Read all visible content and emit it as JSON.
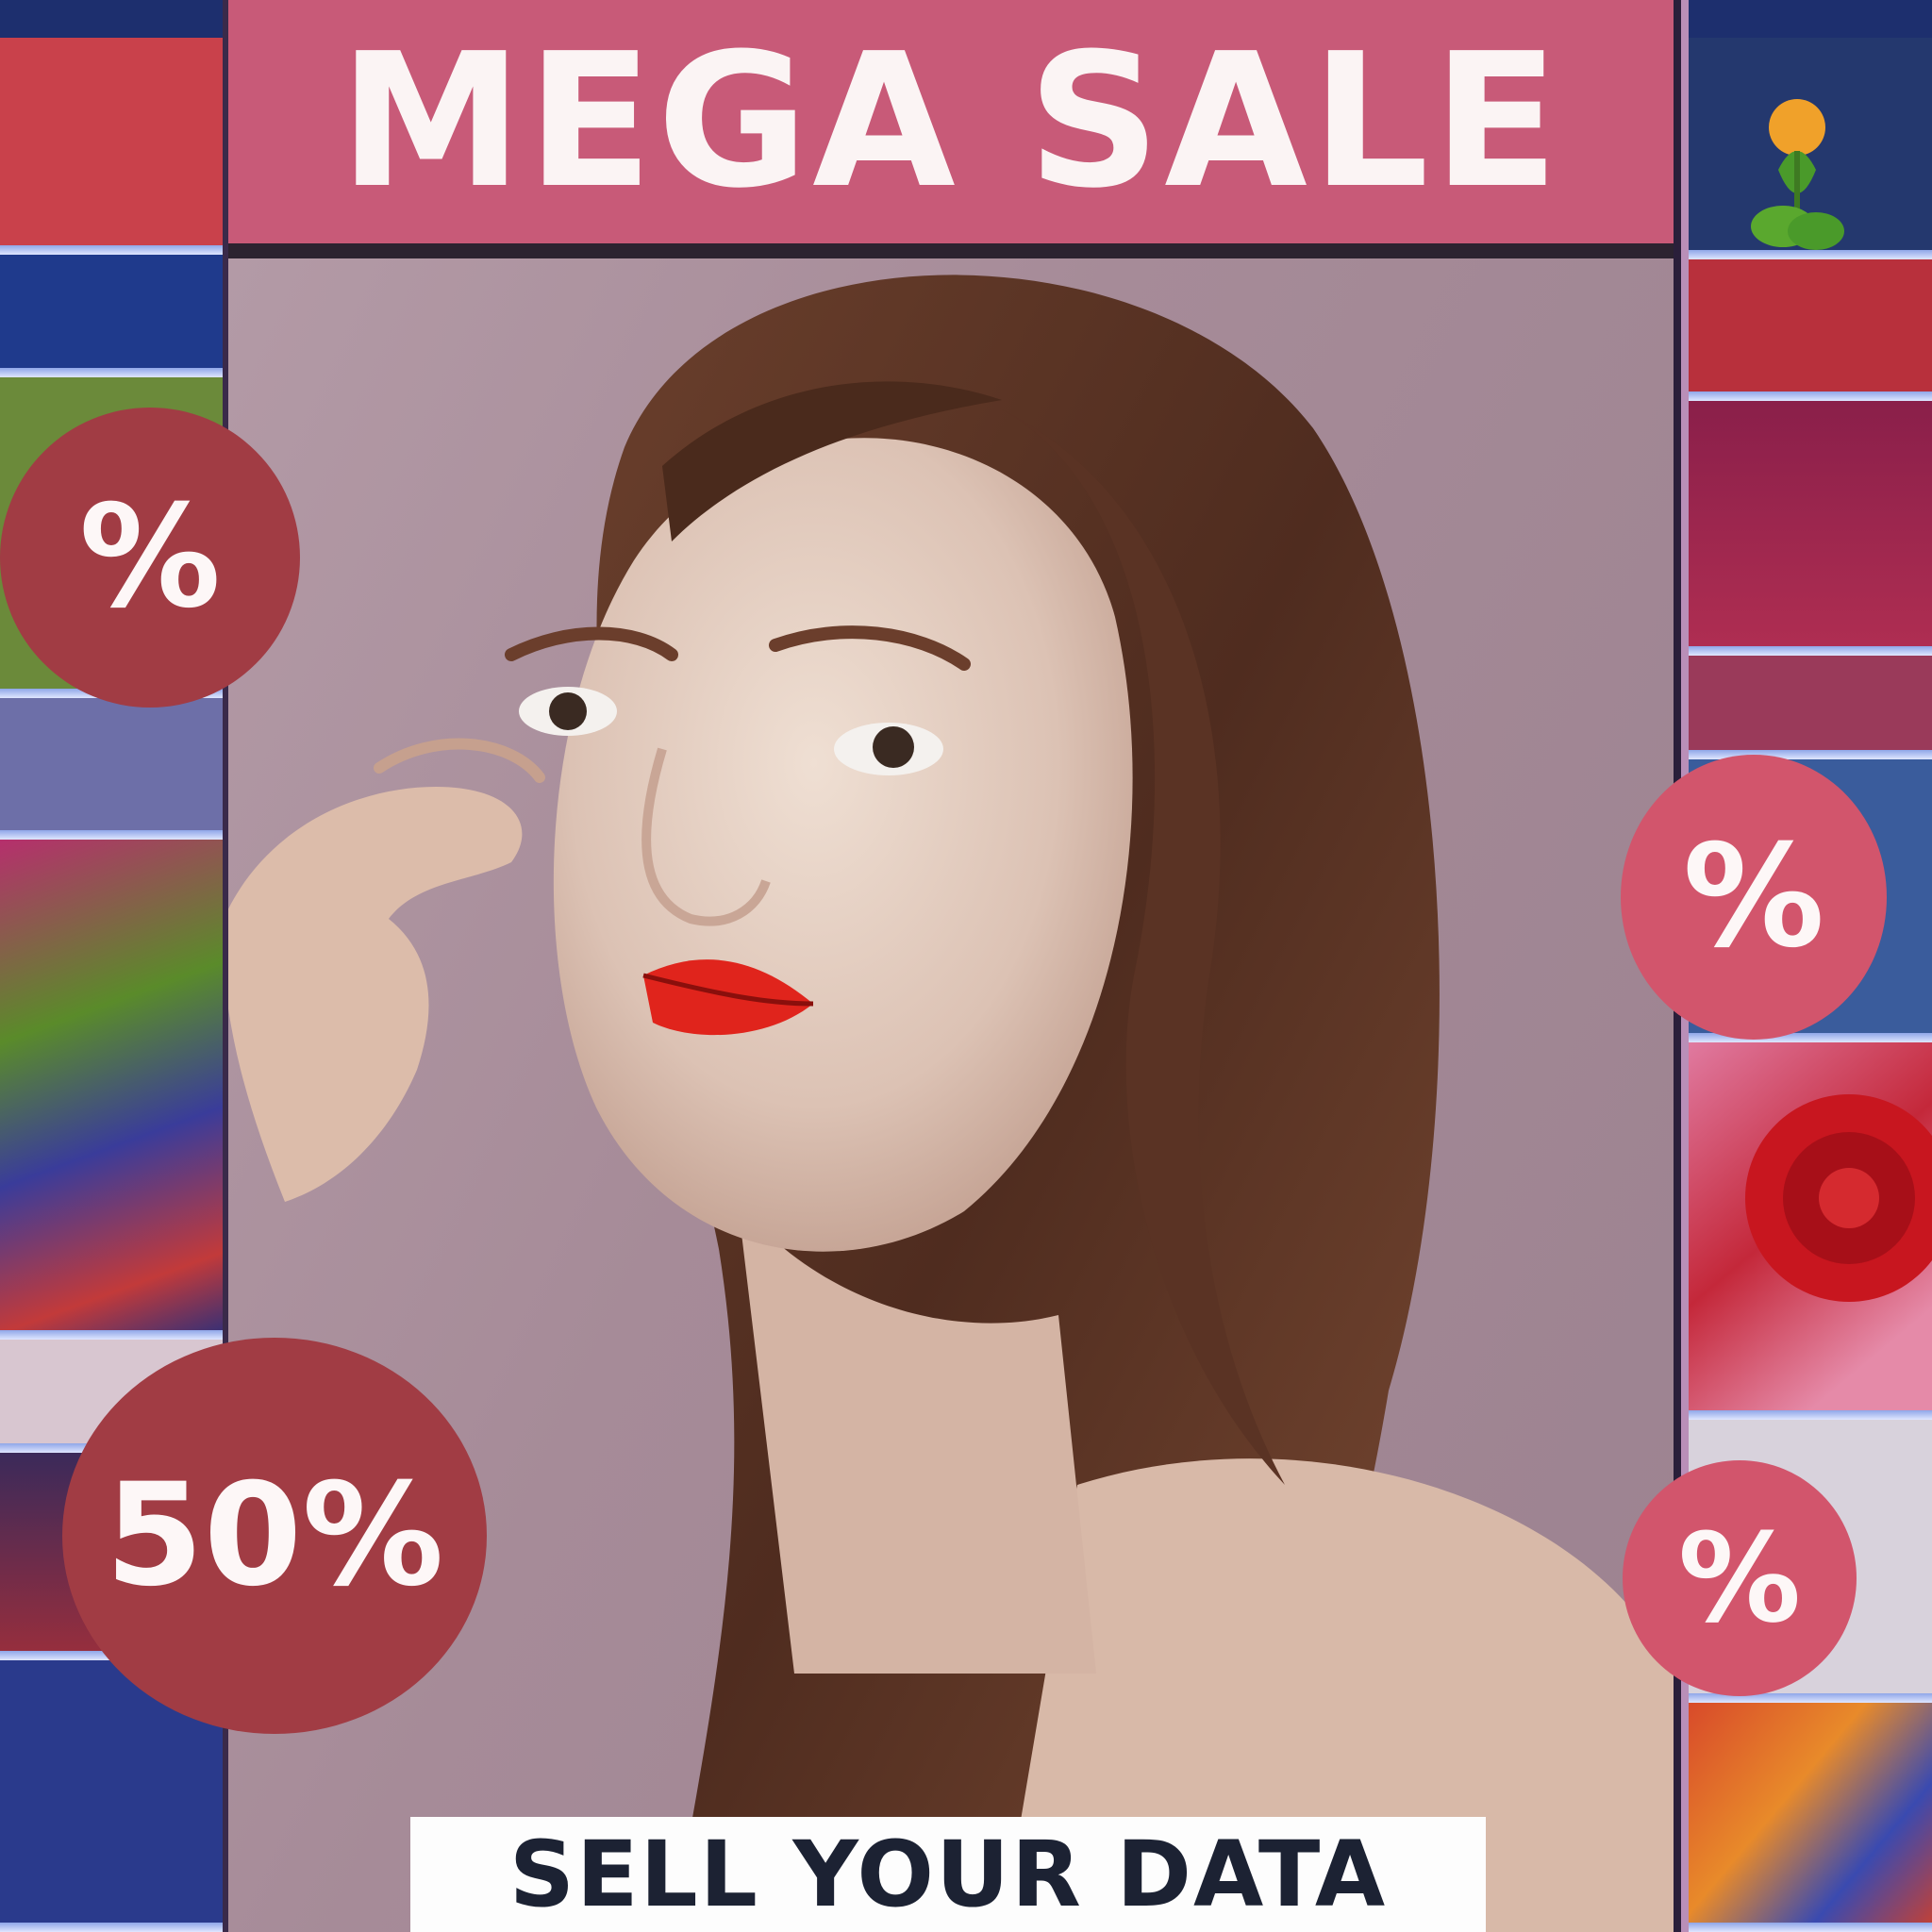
{
  "poster": {
    "headline": "MEGA SALE",
    "footer": "SELL YOUR DATA"
  },
  "badges": {
    "left_top": "%",
    "left_bottom": "50%",
    "right_top": "%",
    "right_bottom": "%"
  },
  "colors": {
    "banner": "#c85a78",
    "badge_dark": "#a13c44",
    "badge_light": "#d2556c",
    "footer_bg": "#fdfdfd",
    "footer_text": "#1c2233"
  }
}
